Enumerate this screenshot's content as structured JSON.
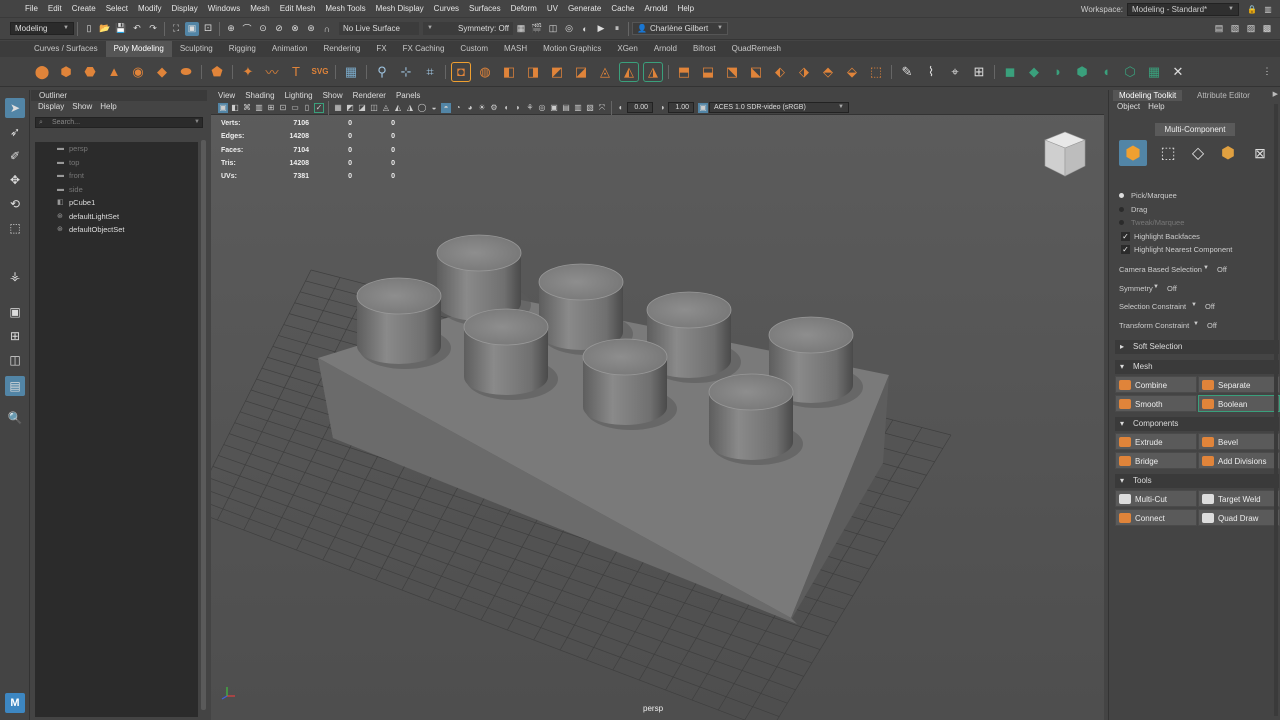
{
  "menubar": {
    "items": [
      "File",
      "Edit",
      "Create",
      "Select",
      "Modify",
      "Display",
      "Windows",
      "Mesh",
      "Edit Mesh",
      "Mesh Tools",
      "Mesh Display",
      "Curves",
      "Surfaces",
      "Deform",
      "UV",
      "Generate",
      "Cache",
      "Arnold",
      "Help"
    ],
    "workspace_label": "Workspace:",
    "workspace_value": "Modeling - Standard*"
  },
  "statusline": {
    "mode": "Modeling",
    "live_surface": "No Live Surface",
    "symmetry": "Symmetry: Off",
    "user": "Charlène Gilbert"
  },
  "shelf_tabs": [
    "Curves / Surfaces",
    "Poly Modeling",
    "Sculpting",
    "Rigging",
    "Animation",
    "Rendering",
    "FX",
    "FX Caching",
    "Custom",
    "MASH",
    "Motion Graphics",
    "XGen",
    "Arnold",
    "Bifrost",
    "QuadRemesh"
  ],
  "active_shelf_tab": "Poly Modeling",
  "outliner": {
    "title": "Outliner",
    "menu": [
      "Display",
      "Show",
      "Help"
    ],
    "search_placeholder": "Search...",
    "items": [
      {
        "label": "persp",
        "dim": true
      },
      {
        "label": "top",
        "dim": true
      },
      {
        "label": "front",
        "dim": true
      },
      {
        "label": "side",
        "dim": true
      },
      {
        "label": "pCube1",
        "dim": false
      },
      {
        "label": "defaultLightSet",
        "dim": false
      },
      {
        "label": "defaultObjectSet",
        "dim": false
      }
    ]
  },
  "viewport": {
    "menu": [
      "View",
      "Shading",
      "Lighting",
      "Show",
      "Renderer",
      "Panels"
    ],
    "exposure": "0.00",
    "gamma": "1.00",
    "color_space": "ACES 1.0 SDR-video (sRGB)",
    "camera": "persp",
    "hud": [
      {
        "label": "Verts:",
        "v1": "7106",
        "v2": "0",
        "v3": "0"
      },
      {
        "label": "Edges:",
        "v1": "14208",
        "v2": "0",
        "v3": "0"
      },
      {
        "label": "Faces:",
        "v1": "7104",
        "v2": "0",
        "v3": "0"
      },
      {
        "label": "Tris:",
        "v1": "14208",
        "v2": "0",
        "v3": "0"
      },
      {
        "label": "UVs:",
        "v1": "7381",
        "v2": "0",
        "v3": "0"
      }
    ]
  },
  "toolkit": {
    "tab_active": "Modeling Toolkit",
    "tab_other": "Attribute Editor",
    "menu": [
      "Object",
      "Help"
    ],
    "multi_component": "Multi-Component",
    "pick_marquee": "Pick/Marquee",
    "drag": "Drag",
    "tweak_marquee": "Tweak/Marquee",
    "highlight_backfaces": "Highlight Backfaces",
    "highlight_nearest": "Highlight Nearest Component",
    "camera_based": "Camera Based Selection",
    "camera_based_value": "Off",
    "symmetry": "Symmetry",
    "symmetry_value": "Off",
    "selection_constraint": "Selection Constraint",
    "selection_constraint_value": "Off",
    "transform_constraint": "Transform Constraint",
    "transform_constraint_value": "Off",
    "soft_selection": "Soft Selection",
    "mesh": "Mesh",
    "combine": "Combine",
    "separate": "Separate",
    "smooth": "Smooth",
    "boolean": "Boolean",
    "components": "Components",
    "extrude": "Extrude",
    "bevel": "Bevel",
    "bridge": "Bridge",
    "add_divisions": "Add Divisions",
    "tools": "Tools",
    "multi_cut": "Multi-Cut",
    "target_weld": "Target Weld",
    "connect": "Connect",
    "quad_draw": "Quad Draw"
  },
  "colors": {
    "accent": "#5285a6",
    "shelf_orange": "#e0843a",
    "shelf_green": "#3aa07c",
    "highlight_orange": "#f0a030"
  }
}
